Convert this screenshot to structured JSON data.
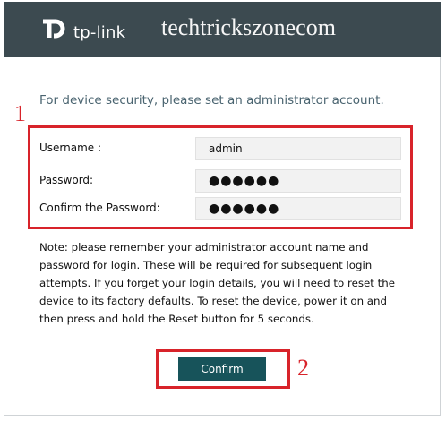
{
  "header": {
    "brand": "tp-link",
    "watermark": "techtrickszonecom"
  },
  "annotations": {
    "one": "1",
    "two": "2"
  },
  "intro": "For device security, please set an administrator account.",
  "form": {
    "username_label": "Username :",
    "username_value": "admin",
    "password_label": "Password:",
    "password_value": "●●●●●●",
    "confirm_label": "Confirm the Password:",
    "confirm_value": "●●●●●●"
  },
  "note": "Note: please remember your administrator account name and password for login. These will be required for subsequent login attempts. If you forget your login details, you will need to reset the device to its factory defaults. To reset the device, power it on and then press and hold the Reset button for 5 seconds.",
  "confirm_button": "Confirm",
  "colors": {
    "header": "#3c4a50",
    "button": "#17535a",
    "annotation": "#d8232a"
  }
}
